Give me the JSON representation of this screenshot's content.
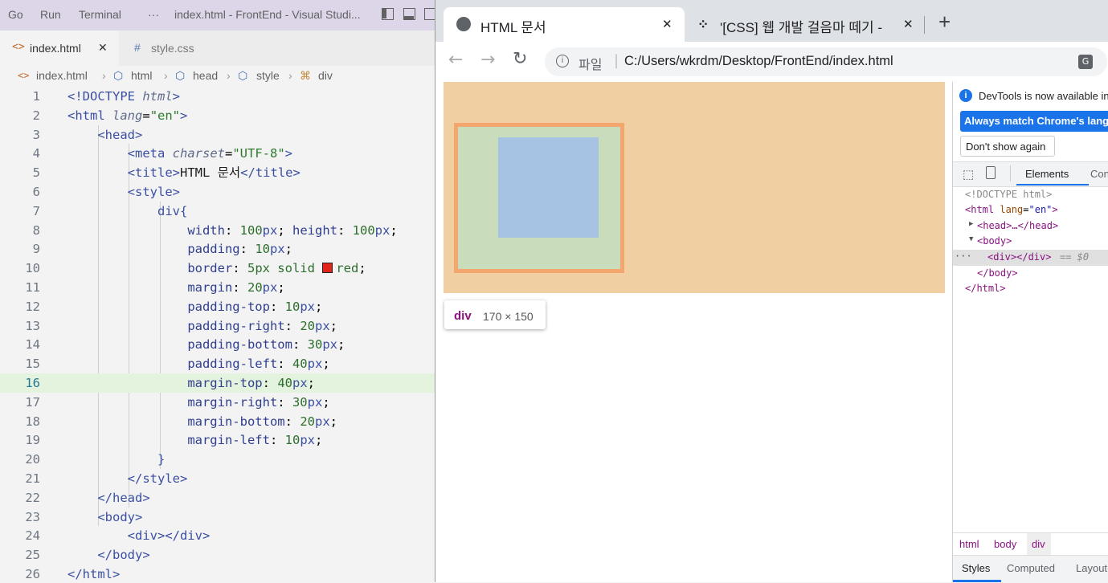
{
  "vscode": {
    "menu": [
      "Go",
      "Run",
      "Terminal",
      "···"
    ],
    "window_title": "index.html - FrontEnd - Visual Studi...",
    "tabs": [
      {
        "label": "index.html",
        "icon": "<>",
        "active": true,
        "close": "✕"
      },
      {
        "label": "style.css",
        "icon": "#",
        "active": false
      }
    ],
    "breadcrumb": [
      "index.html",
      "html",
      "head",
      "style",
      "div"
    ],
    "highlight_line": 16,
    "lines": [
      {
        "n": "1",
        "html": "<span class=\"t-tag\">&lt;!DOCTYPE</span> <span class=\"t-attr\">html</span><span class=\"t-tag\">&gt;</span>"
      },
      {
        "n": "2",
        "html": "<span class=\"t-tag\">&lt;html</span> <span class=\"t-attr\">lang</span>=<span class=\"t-str\">\"en\"</span><span class=\"t-tag\">&gt;</span>"
      },
      {
        "n": "3",
        "html": "    <span class=\"t-tag\">&lt;head&gt;</span>"
      },
      {
        "n": "4",
        "html": "        <span class=\"t-tag\">&lt;meta</span> <span class=\"t-attr\">charset</span>=<span class=\"t-str\">\"UTF-8\"</span><span class=\"t-tag\">&gt;</span>"
      },
      {
        "n": "5",
        "html": "        <span class=\"t-tag\">&lt;title&gt;</span><span class=\"t-txt\">HTML 문서</span><span class=\"t-tag\">&lt;/title&gt;</span>"
      },
      {
        "n": "6",
        "html": "        <span class=\"t-tag\">&lt;style&gt;</span>"
      },
      {
        "n": "7",
        "html": "            <span class=\"t-tag\">div{</span>"
      },
      {
        "n": "8",
        "html": "                <span class=\"t-prop\">width</span>: <span class=\"t-num\">100</span><span class=\"t-unit\">px</span>; <span class=\"t-prop\">height</span>: <span class=\"t-num\">100</span><span class=\"t-unit\">px</span>;"
      },
      {
        "n": "9",
        "html": "                <span class=\"t-prop\">padding</span>: <span class=\"t-num\">10</span><span class=\"t-unit\">px</span>;"
      },
      {
        "n": "10",
        "html": "                <span class=\"t-prop\">border</span>: <span class=\"t-num\">5px solid</span> <span class=\"swatch\"></span><span class=\"t-num\">red</span>;"
      },
      {
        "n": "11",
        "html": "                <span class=\"t-prop\">margin</span>: <span class=\"t-num\">20</span><span class=\"t-unit\">px</span>;"
      },
      {
        "n": "12",
        "html": "                <span class=\"t-prop\">padding-top</span>: <span class=\"t-num\">10</span><span class=\"t-unit\">px</span>;"
      },
      {
        "n": "13",
        "html": "                <span class=\"t-prop\">padding-right</span>: <span class=\"t-num\">20</span><span class=\"t-unit\">px</span>;"
      },
      {
        "n": "14",
        "html": "                <span class=\"t-prop\">padding-bottom</span>: <span class=\"t-num\">30</span><span class=\"t-unit\">px</span>;"
      },
      {
        "n": "15",
        "html": "                <span class=\"t-prop\">padding-left</span>: <span class=\"t-num\">40</span><span class=\"t-unit\">px</span>;"
      },
      {
        "n": "16",
        "html": "                <span class=\"t-prop\">margin-top</span>: <span class=\"t-num\">40</span><span class=\"t-unit\">px</span>;"
      },
      {
        "n": "17",
        "html": "                <span class=\"t-prop\">margin-right</span>: <span class=\"t-num\">30</span><span class=\"t-unit\">px</span>;"
      },
      {
        "n": "18",
        "html": "                <span class=\"t-prop\">margin-bottom</span>: <span class=\"t-num\">20</span><span class=\"t-unit\">px</span>;"
      },
      {
        "n": "19",
        "html": "                <span class=\"t-prop\">margin-left</span>: <span class=\"t-num\">10</span><span class=\"t-unit\">px</span>;"
      },
      {
        "n": "20",
        "html": "            <span class=\"t-tag\">}</span>"
      },
      {
        "n": "21",
        "html": "        <span class=\"t-tag\">&lt;/style&gt;</span>"
      },
      {
        "n": "22",
        "html": "    <span class=\"t-tag\">&lt;/head&gt;</span>"
      },
      {
        "n": "23",
        "html": "    <span class=\"t-tag\">&lt;body&gt;</span>"
      },
      {
        "n": "24",
        "html": "        <span class=\"t-tag\">&lt;div&gt;&lt;/div&gt;</span>"
      },
      {
        "n": "25",
        "html": "    <span class=\"t-tag\">&lt;/body&gt;</span>"
      },
      {
        "n": "26",
        "html": "<span class=\"t-tag\">&lt;/html&gt;</span>"
      }
    ]
  },
  "chrome": {
    "tabs": [
      {
        "title": "HTML 문서",
        "close": "✕",
        "active": true
      },
      {
        "title": "'[CSS] 웹 개발 걸음마 떼기 -",
        "close": "✕",
        "active": false
      }
    ],
    "new_tab": "+",
    "omnibox": {
      "prefix": "파일",
      "url": "C:/Users/wkrdm/Desktop/FrontEnd/index.html"
    },
    "tooltip": {
      "tag": "div",
      "size": "170 × 150"
    },
    "colors": {
      "page_bg": "#f0cfa2",
      "border": "#f3a66e",
      "padding": "#c9dcbc",
      "content": "#a6c3e3"
    }
  },
  "devtools": {
    "notice": "DevTools is now available in",
    "match_button": "Always match Chrome's langu",
    "dont_show": "Don't show again",
    "tabs": [
      "Elements",
      "Con"
    ],
    "dom": {
      "doctype": "<!DOCTYPE html>",
      "html_open_tag": "<html",
      "html_attr": "lang",
      "html_val": "\"en\"",
      "head": "<head>…</head>",
      "body_open": "<body>",
      "div": "<div></div>",
      "div_eq": "== $0",
      "ellipsis": "···",
      "body_close": "</body>",
      "html_close": "</html>"
    },
    "crumbs": [
      "html",
      "body",
      "div"
    ],
    "bottom_tabs": [
      "Styles",
      "Computed",
      "Layout"
    ]
  }
}
